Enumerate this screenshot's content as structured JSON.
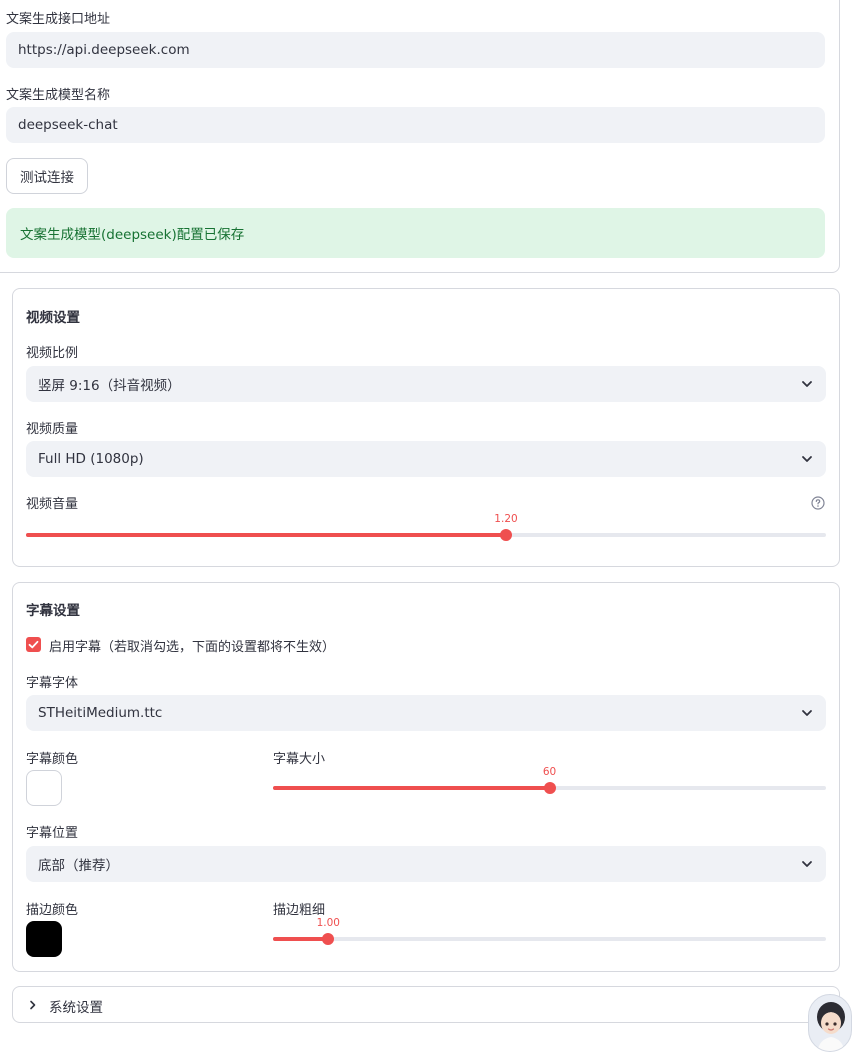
{
  "api_section": {
    "endpoint_label": "文案生成接口地址",
    "endpoint_value": "https://api.deepseek.com",
    "model_label": "文案生成模型名称",
    "model_value": "deepseek-chat",
    "test_button": "测试连接",
    "success_message": "文案生成模型(deepseek)配置已保存"
  },
  "video_settings": {
    "title": "视频设置",
    "ratio_label": "视频比例",
    "ratio_value": "竖屏 9:16（抖音视频）",
    "quality_label": "视频质量",
    "quality_value": "Full HD (1080p)",
    "volume_label": "视频音量",
    "volume_value": "1.20",
    "volume_fraction": 0.6
  },
  "subtitle_settings": {
    "title": "字幕设置",
    "enable_label": "启用字幕（若取消勾选，下面的设置都将不生效）",
    "enable_checked": true,
    "font_label": "字幕字体",
    "font_value": "STHeitiMedium.ttc",
    "color_label": "字幕颜色",
    "color_value": "#ffffff",
    "size_label": "字幕大小",
    "size_value": "60",
    "size_fraction": 0.5,
    "position_label": "字幕位置",
    "position_value": "底部（推荐）",
    "stroke_color_label": "描边颜色",
    "stroke_color_value": "#000000",
    "stroke_width_label": "描边粗细",
    "stroke_width_value": "1.00",
    "stroke_width_fraction": 0.1
  },
  "system_settings": {
    "label": "系统设置"
  },
  "colors": {
    "accent": "#ef4f4f",
    "input_bg": "#f0f2f6",
    "success_bg": "#dff5e6",
    "success_text": "#177233"
  }
}
